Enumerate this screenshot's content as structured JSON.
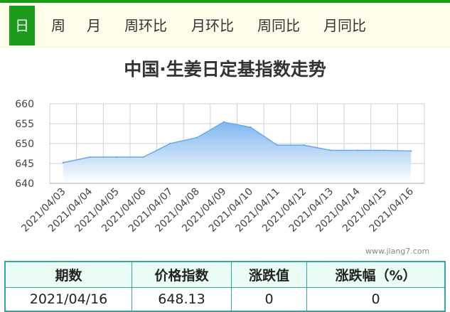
{
  "tabs": [
    {
      "label": "日",
      "active": true
    },
    {
      "label": "周",
      "active": false
    },
    {
      "label": "月",
      "active": false
    },
    {
      "label": "周环比",
      "active": false
    },
    {
      "label": "月环比",
      "active": false
    },
    {
      "label": "周同比",
      "active": false
    },
    {
      "label": "月同比",
      "active": false
    }
  ],
  "colors": {
    "accent": "#1a9b1a",
    "area_top": "#7fb6ee",
    "area_bottom": "#ffffff",
    "line": "#6aa8e8",
    "table_border": "#3aa39a"
  },
  "watermark": "www.jiang7.com",
  "chart_data": {
    "type": "area",
    "title": "中国·生姜日定基指数走势",
    "categories": [
      "2021/04/03",
      "2021/04/04",
      "2021/04/05",
      "2021/04/06",
      "2021/04/07",
      "2021/04/08",
      "2021/04/09",
      "2021/04/10",
      "2021/04/11",
      "2021/04/12",
      "2021/04/13",
      "2021/04/14",
      "2021/04/15",
      "2021/04/16"
    ],
    "series": [
      {
        "values": [
          645.2,
          646.6,
          646.6,
          646.6,
          650.0,
          651.5,
          655.4,
          654.1,
          649.6,
          649.6,
          648.3,
          648.3,
          648.3,
          648.13
        ]
      }
    ],
    "ylim": [
      640,
      660
    ],
    "yticks": [
      "640",
      "645",
      "650",
      "655",
      "660"
    ],
    "grid": true
  },
  "table": {
    "headers": [
      "期数",
      "价格指数",
      "涨跌值",
      "涨跌幅（%）"
    ],
    "row": [
      "2021/04/16",
      "648.13",
      "0",
      "0"
    ]
  }
}
